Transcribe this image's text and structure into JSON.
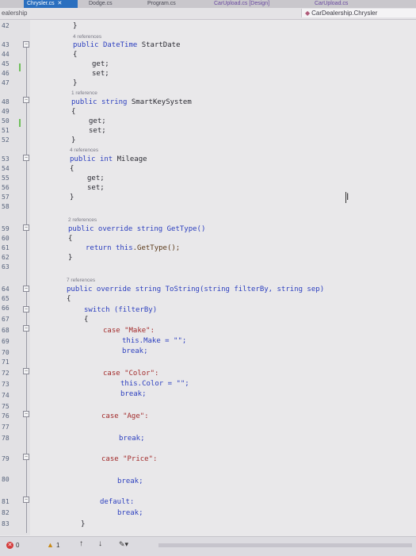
{
  "tabs": [
    {
      "label": "Chrysler.cs",
      "active": true
    },
    {
      "label": "Dodge.cs",
      "active": false
    },
    {
      "label": "Program.cs",
      "active": false
    },
    {
      "label": "CarUpload.cs [Design]",
      "active": false
    },
    {
      "label": "CarUpload.cs",
      "active": false
    }
  ],
  "nav": {
    "left": "ealership",
    "right": "CarDealership.Chrysler"
  },
  "line_numbers": [
    "42",
    "43",
    "44",
    "45",
    "46",
    "47",
    "48",
    "49",
    "50",
    "51",
    "52",
    "53",
    "54",
    "55",
    "56",
    "57",
    "58",
    "59",
    "60",
    "61",
    "62",
    "63",
    "64",
    "65",
    "66",
    "67",
    "68",
    "69",
    "70",
    "71",
    "72",
    "73",
    "74",
    "75",
    "76",
    "77",
    "78",
    "79",
    "80",
    "81",
    "82",
    "83"
  ],
  "refs": {
    "r1": "4 references",
    "r2": "1 reference",
    "r3": "4 references",
    "r4": "2 references",
    "r5": "7 references"
  },
  "code": {
    "l1_kw": "public",
    "l1_type": "DateTime",
    "l1_name": "StartDate",
    "l2_kw": "public",
    "l2_type": "string",
    "l2_name": "SmartKeySystem",
    "l3_kw": "public",
    "l3_type": "int",
    "l3_name": "Mileage",
    "get": "get;",
    "set": "set;",
    "open": "{",
    "close": "}",
    "gettype_sig": "public override string GetType()",
    "gettype_body_kw": "return",
    "gettype_body_this": "this",
    "gettype_body_rest": ".GetType();",
    "tostring_sig": "public override string ToString(string filterBy, string sep)",
    "switch": "switch (filterBy)",
    "case_make": "case \"Make\":",
    "this_make": "this.Make = \"\";",
    "break": "break;",
    "case_color": "case \"Color\":",
    "this_color": "this.Color = \"\";",
    "case_age": "case \"Age\":",
    "case_price": "case \"Price\":",
    "default": "default:"
  },
  "status": {
    "errors": "0",
    "warnings": "1"
  }
}
